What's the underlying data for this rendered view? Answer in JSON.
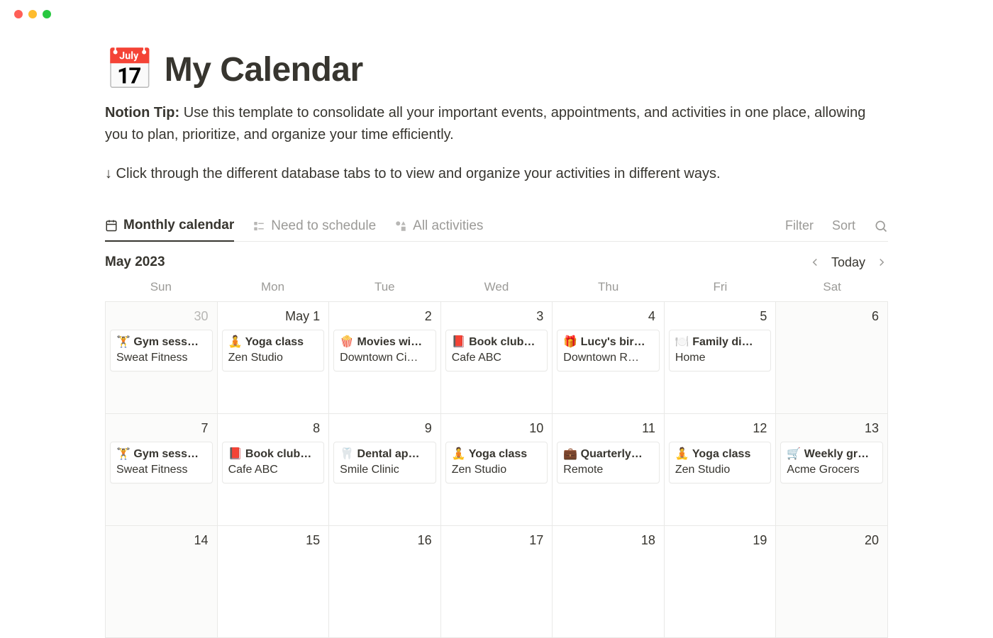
{
  "page": {
    "icon": "📅",
    "title": "My Calendar",
    "tip_label": "Notion Tip:",
    "tip_body": "Use this template to consolidate all your important events, appointments, and activities in one place, allowing you to plan, prioritize, and organize your time efficiently.",
    "subtip": "↓ Click through the different database tabs to to view and organize your activities in different ways."
  },
  "tabs": {
    "monthly": "Monthly calendar",
    "need": "Need to schedule",
    "all": "All activities"
  },
  "toolbar": {
    "filter": "Filter",
    "sort": "Sort"
  },
  "calendar": {
    "month_label": "May 2023",
    "today": "Today",
    "dow": [
      "Sun",
      "Mon",
      "Tue",
      "Wed",
      "Thu",
      "Fri",
      "Sat"
    ],
    "cells": [
      {
        "date": "30",
        "prev": true,
        "weekend": true,
        "events": [
          {
            "icon": "🏋️",
            "title": "Gym sess…",
            "sub": "Sweat Fitness"
          }
        ]
      },
      {
        "date": "May 1",
        "events": [
          {
            "icon": "🧘",
            "title": "Yoga class",
            "sub": "Zen Studio"
          }
        ]
      },
      {
        "date": "2",
        "events": [
          {
            "icon": "🍿",
            "title": "Movies wi…",
            "sub": "Downtown Ci…"
          }
        ]
      },
      {
        "date": "3",
        "events": [
          {
            "icon": "📕",
            "title": "Book club…",
            "sub": "Cafe ABC"
          }
        ]
      },
      {
        "date": "4",
        "events": [
          {
            "icon": "🎁",
            "title": "Lucy's bir…",
            "sub": "Downtown R…"
          }
        ]
      },
      {
        "date": "5",
        "events": [
          {
            "icon": "🍽️",
            "title": "Family di…",
            "sub": "Home"
          }
        ]
      },
      {
        "date": "6",
        "weekend": true,
        "events": []
      },
      {
        "date": "7",
        "weekend": true,
        "events": [
          {
            "icon": "🏋️",
            "title": "Gym sess…",
            "sub": "Sweat Fitness"
          }
        ]
      },
      {
        "date": "8",
        "events": [
          {
            "icon": "📕",
            "title": "Book club…",
            "sub": "Cafe ABC"
          }
        ]
      },
      {
        "date": "9",
        "events": [
          {
            "icon": "🦷",
            "title": "Dental ap…",
            "sub": "Smile Clinic"
          }
        ]
      },
      {
        "date": "10",
        "events": [
          {
            "icon": "🧘",
            "title": "Yoga class",
            "sub": "Zen Studio"
          }
        ]
      },
      {
        "date": "11",
        "events": [
          {
            "icon": "💼",
            "title": "Quarterly…",
            "sub": "Remote"
          }
        ]
      },
      {
        "date": "12",
        "events": [
          {
            "icon": "🧘",
            "title": "Yoga class",
            "sub": "Zen Studio"
          }
        ]
      },
      {
        "date": "13",
        "weekend": true,
        "events": [
          {
            "icon": "🛒",
            "title": "Weekly gr…",
            "sub": "Acme Grocers"
          }
        ]
      },
      {
        "date": "14",
        "weekend": true,
        "events": []
      },
      {
        "date": "15",
        "events": []
      },
      {
        "date": "16",
        "events": []
      },
      {
        "date": "17",
        "events": []
      },
      {
        "date": "18",
        "events": []
      },
      {
        "date": "19",
        "events": []
      },
      {
        "date": "20",
        "weekend": true,
        "events": []
      }
    ]
  }
}
